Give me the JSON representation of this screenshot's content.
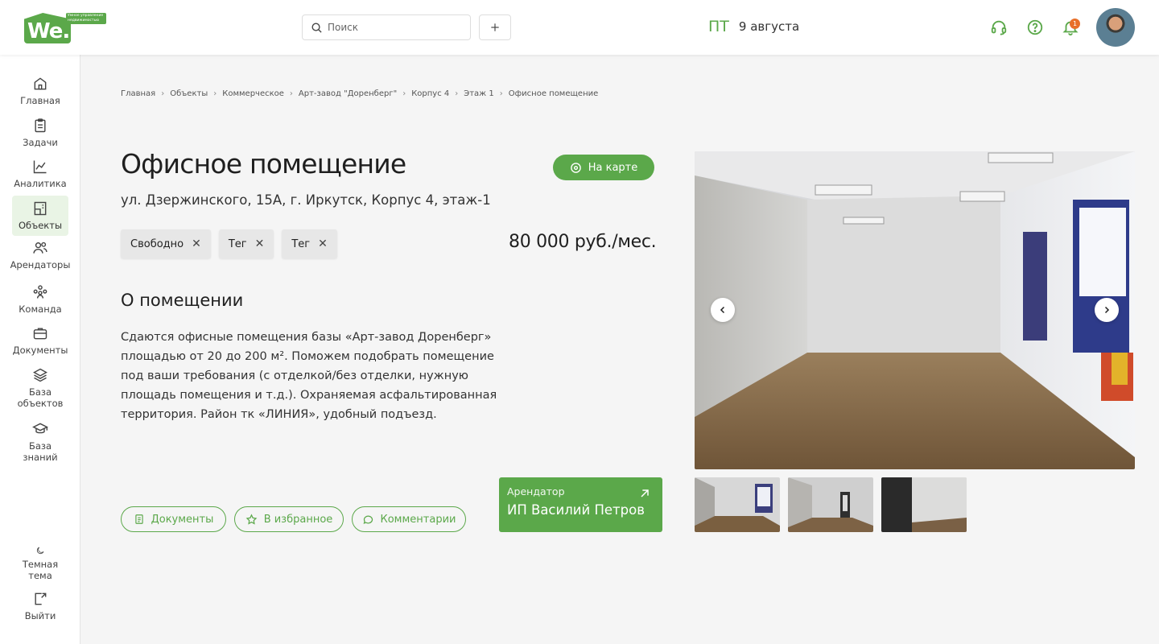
{
  "header": {
    "logo_text": "We.",
    "logo_tagline": "Умное управление недвижимостью",
    "search_placeholder": "Поиск",
    "day": "ПТ",
    "date": "9 августа",
    "notification_count": "1"
  },
  "sidebar": {
    "items": [
      {
        "label": "Главная",
        "icon": "home-icon"
      },
      {
        "label": "Задачи",
        "icon": "clipboard-icon"
      },
      {
        "label": "Аналитика",
        "icon": "chart-icon"
      },
      {
        "label": "Объекты",
        "icon": "building-icon",
        "active": true
      },
      {
        "label": "Арендаторы",
        "icon": "users-icon"
      },
      {
        "label": "Команда",
        "icon": "team-icon"
      },
      {
        "label": "Документы",
        "icon": "briefcase-icon"
      },
      {
        "label": "База объектов",
        "icon": "layers-icon"
      },
      {
        "label": "База знаний",
        "icon": "graduation-cap-icon"
      }
    ],
    "theme_label": "Темная тема",
    "logout_label": "Выйти"
  },
  "breadcrumb": [
    "Главная",
    "Объекты",
    "Коммерческое",
    "Арт-завод \"Доренберг\"",
    "Корпус 4",
    "Этаж 1",
    "Офисное помещение"
  ],
  "object": {
    "title": "Офисное помещение",
    "map_button": "На карте",
    "address": "ул. Дзержинского, 15А, г. Иркутск, Корпус 4, этаж-1",
    "tags": [
      "Свободно",
      "Тег",
      "Тег"
    ],
    "price": "80 000  руб./мес.",
    "about_title": "О помещении",
    "about_text": "Сдаются офисные помещения базы «Арт-завод Доренберг» площадью от 20 до 200 м². Поможем подобрать помещение под ваши требования (с отделкой/без отделки, нужную площадь помещения и т.д.). Охраняемая асфальтированная территория. Район тк «ЛИНИЯ», удобный подъезд.",
    "actions": {
      "documents": "Документы",
      "favorite": "В избранное",
      "comments": "Комментарии"
    },
    "tenant": {
      "label": "Арендатор",
      "name": "ИП Василий Петров"
    }
  },
  "colors": {
    "brand": "#5ba84a",
    "badge": "#e8702a"
  }
}
